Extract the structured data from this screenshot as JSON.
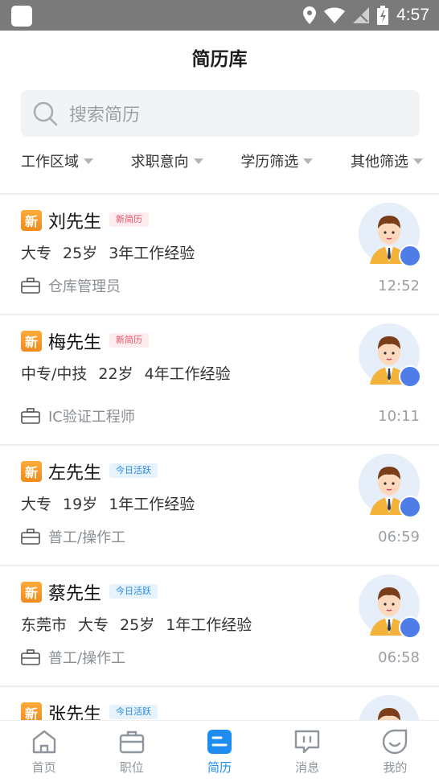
{
  "status_bar": {
    "time": "4:57"
  },
  "header": {
    "title": "简历库"
  },
  "search": {
    "placeholder": "搜索简历"
  },
  "filters": [
    "工作区域",
    "求职意向",
    "学历筛选",
    "其他筛选"
  ],
  "resumes": [
    {
      "badge": "新",
      "name": "刘先生",
      "tag": "新简历",
      "tag_type": "new",
      "meta": [
        "大专",
        "25岁",
        "3年工作经验"
      ],
      "job": "仓库管理员",
      "time": "12:52"
    },
    {
      "badge": "新",
      "name": "梅先生",
      "tag": "新简历",
      "tag_type": "new",
      "meta": [
        "中专/中技",
        "22岁",
        "4年工作经验"
      ],
      "job": "IC验证工程师",
      "time": "10:11"
    },
    {
      "badge": "新",
      "name": "左先生",
      "tag": "今日活跃",
      "tag_type": "active",
      "meta": [
        "大专",
        "19岁",
        "1年工作经验"
      ],
      "job": "普工/操作工",
      "time": "06:59"
    },
    {
      "badge": "新",
      "name": "蔡先生",
      "tag": "今日活跃",
      "tag_type": "active",
      "meta": [
        "东莞市",
        "大专",
        "25岁",
        "1年工作经验"
      ],
      "job": "普工/操作工",
      "time": "06:58"
    },
    {
      "badge": "新",
      "name": "张先生",
      "tag": "今日活跃",
      "tag_type": "active",
      "meta": [],
      "job": "",
      "time": ""
    }
  ],
  "bottom_nav": [
    {
      "label": "首页",
      "icon": "home-icon",
      "active": false
    },
    {
      "label": "职位",
      "icon": "briefcase-icon",
      "active": false
    },
    {
      "label": "简历",
      "icon": "resume-icon",
      "active": true
    },
    {
      "label": "消息",
      "icon": "message-icon",
      "active": false
    },
    {
      "label": "我的",
      "icon": "profile-icon",
      "active": false
    }
  ],
  "colors": {
    "accent": "#1f8cf0",
    "new_badge": "#f39a2a",
    "tag_new_text": "#e5556a",
    "tag_active_text": "#2b8ae0",
    "gender_badge": "#4f7de8"
  }
}
